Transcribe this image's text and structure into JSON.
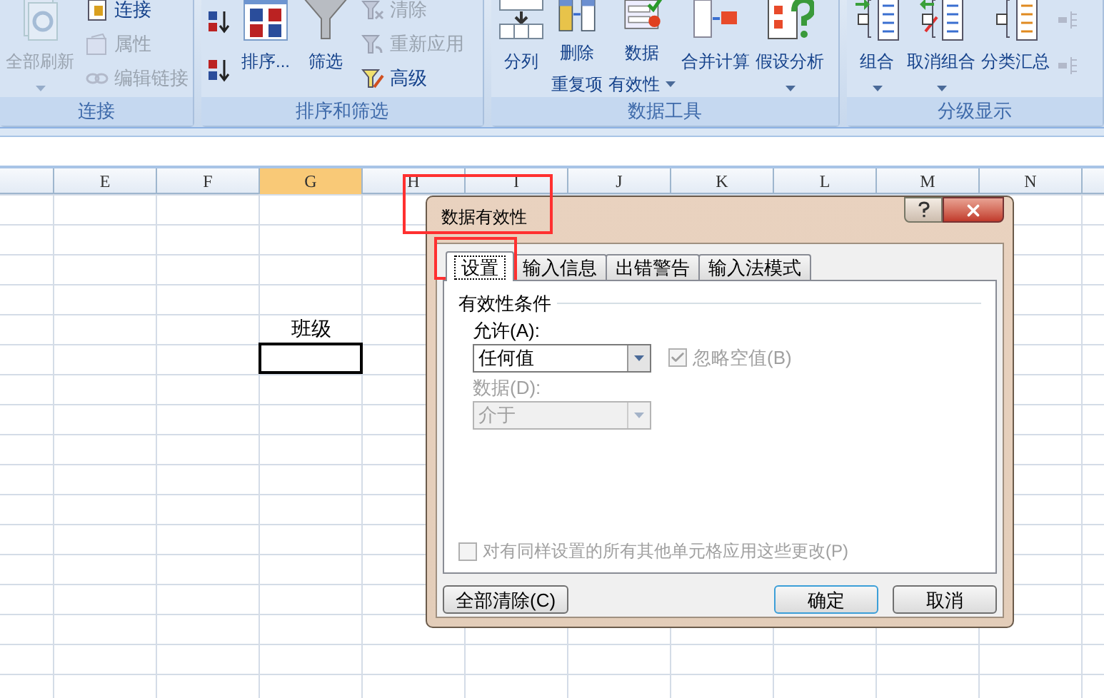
{
  "ribbon": {
    "groups": [
      {
        "label": "连接",
        "items": [
          {
            "kind": "large",
            "lines": [
              "全部刷新"
            ],
            "dropdown": true,
            "disabled": true
          },
          {
            "kind": "stack",
            "children": [
              {
                "label": "连接",
                "disabled": false
              },
              {
                "label": "属性",
                "disabled": true
              },
              {
                "label": "编辑链接",
                "disabled": true
              }
            ]
          }
        ]
      },
      {
        "label": "排序和筛选",
        "items": [
          {
            "kind": "stack",
            "children": [
              {
                "disabled": false
              },
              {
                "disabled": false
              }
            ]
          },
          {
            "kind": "large",
            "lines": [
              "排序..."
            ],
            "dropdown": false,
            "disabled": false
          },
          {
            "kind": "large",
            "lines": [
              "筛选"
            ],
            "dropdown": false,
            "disabled": false
          },
          {
            "kind": "stack",
            "children": [
              {
                "label": "清除",
                "disabled": true
              },
              {
                "label": "重新应用",
                "disabled": true
              },
              {
                "label": "高级",
                "disabled": false
              }
            ]
          }
        ]
      },
      {
        "label": "数据工具",
        "items": [
          {
            "kind": "large",
            "lines": [
              "分列"
            ],
            "dropdown": false,
            "disabled": false
          },
          {
            "kind": "large",
            "lines": [
              "删除",
              "重复项"
            ],
            "dropdown": false,
            "disabled": false
          },
          {
            "kind": "large",
            "lines": [
              "数据",
              "有效性"
            ],
            "dropdown": true,
            "disabled": false
          },
          {
            "kind": "large",
            "lines": [
              "合并计算"
            ],
            "dropdown": false,
            "disabled": false
          },
          {
            "kind": "large",
            "lines": [
              "假设分析"
            ],
            "dropdown": true,
            "disabled": false
          }
        ]
      },
      {
        "label": "分级显示",
        "items": [
          {
            "kind": "large",
            "lines": [
              "组合"
            ],
            "dropdown": true,
            "disabled": false
          },
          {
            "kind": "large",
            "lines": [
              "取消组合"
            ],
            "dropdown": true,
            "disabled": false
          },
          {
            "kind": "large",
            "lines": [
              "分类汇总"
            ],
            "dropdown": false,
            "disabled": false
          },
          {
            "kind": "stack",
            "children": [
              {
                "disabled": true
              },
              {
                "disabled": true
              }
            ]
          }
        ]
      }
    ]
  },
  "sheet": {
    "columns": [
      {
        "label": "E",
        "selected": false
      },
      {
        "label": "F",
        "selected": false
      },
      {
        "label": "G",
        "selected": true,
        "text": "班级"
      },
      {
        "label": "H",
        "selected": false
      },
      {
        "label": "I",
        "selected": false
      },
      {
        "label": "J",
        "selected": false
      },
      {
        "label": "K",
        "selected": false
      },
      {
        "label": "L",
        "selected": false
      },
      {
        "label": "M",
        "selected": false
      },
      {
        "label": "N",
        "selected": false
      }
    ]
  },
  "dialog": {
    "title": "数据有效性",
    "tabs": [
      {
        "label": "设置",
        "selected": true
      },
      {
        "label": "输入信息",
        "selected": false
      },
      {
        "label": "出错警告",
        "selected": false
      },
      {
        "label": "输入法模式",
        "selected": false
      }
    ],
    "group_label": "有效性条件",
    "allow": {
      "label": "允许(A):",
      "value": "任何值",
      "disabled": false
    },
    "ignore_blank": {
      "label": "忽略空值(B)",
      "checked": true,
      "disabled": true
    },
    "data": {
      "label": "数据(D):",
      "value": "介于",
      "disabled": true
    },
    "apply_all": {
      "label": "对有同样设置的所有其他单元格应用这些更改(P)",
      "checked": false,
      "disabled": true
    },
    "buttons": [
      {
        "label": "全部清除(C)",
        "kind": "normal"
      },
      {
        "label": "确定",
        "kind": "default"
      },
      {
        "label": "取消",
        "kind": "normal"
      }
    ]
  }
}
